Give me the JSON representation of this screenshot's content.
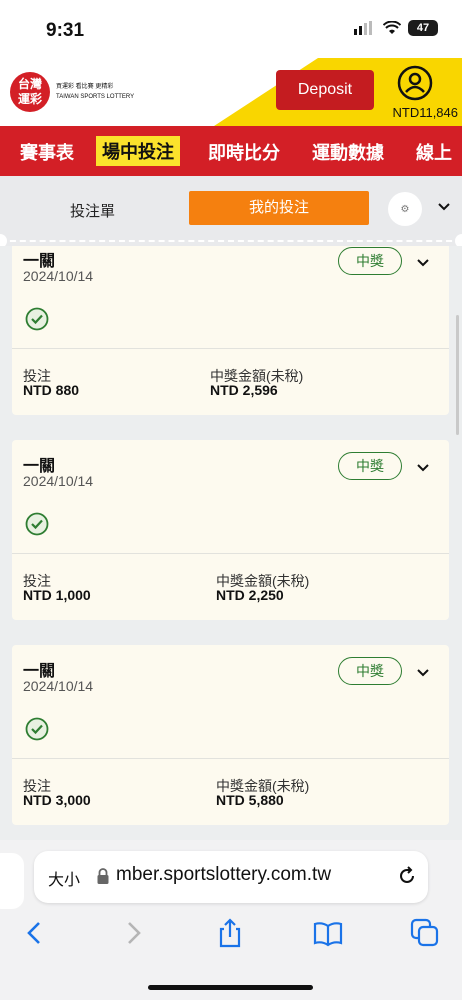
{
  "status": {
    "time": "9:31",
    "battery": "47"
  },
  "header": {
    "logo_line1": "台灣",
    "logo_line2": "運彩",
    "logo_tagline": "買運彩 看比賽 更精彩",
    "logo_sub": "TAIWAN SPORTS LOTTERY",
    "deposit_label": "Deposit",
    "balance": "NTD11,846"
  },
  "nav": {
    "items": [
      "賽事表",
      "場中投注",
      "即時比分",
      "運動數據",
      "線上"
    ]
  },
  "tabs": {
    "slip": "投注單",
    "mine": "我的投注"
  },
  "labels": {
    "stake": "投注",
    "win_amount": "中獎金額(未稅)",
    "badge": "中獎"
  },
  "cards": [
    {
      "title": "一關",
      "date": "2024/10/14",
      "stake": "NTD 880",
      "win": "NTD 2,596"
    },
    {
      "title": "一關",
      "date": "2024/10/14",
      "stake": "NTD 1,000",
      "win": "NTD 2,250"
    },
    {
      "title": "一關",
      "date": "2024/10/14",
      "stake": "NTD 3,000",
      "win": "NTD 5,880"
    }
  ],
  "browser": {
    "text_size": "大小",
    "url": "mber.sportslottery.com.tw"
  },
  "colors": {
    "brand_red": "#d31f26",
    "brand_yellow": "#f9d600",
    "orange": "#f5800f",
    "win_green": "#2e7d32"
  }
}
